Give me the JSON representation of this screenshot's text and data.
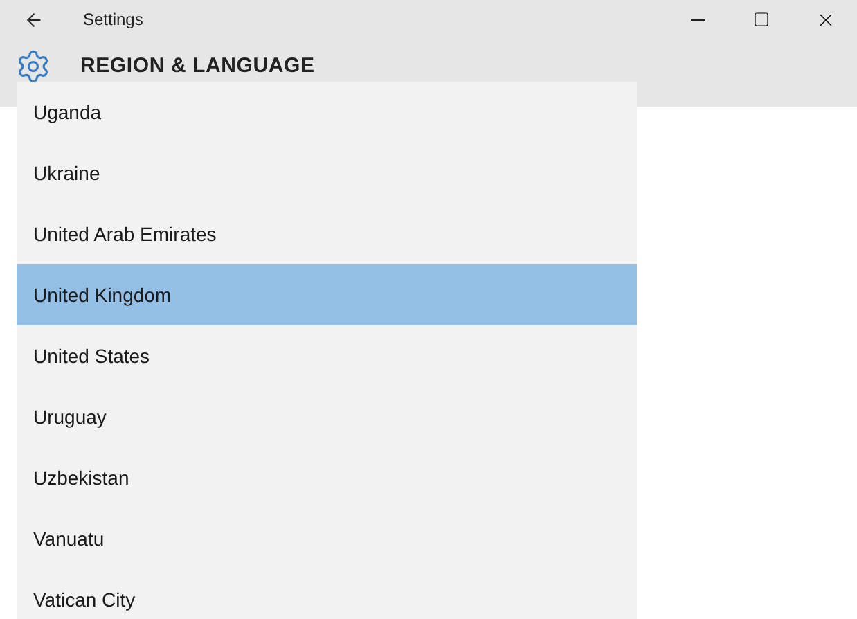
{
  "window": {
    "title": "Settings"
  },
  "header": {
    "title": "REGION & LANGUAGE"
  },
  "dropdown": {
    "items": [
      {
        "label": "Uganda",
        "selected": false
      },
      {
        "label": "Ukraine",
        "selected": false
      },
      {
        "label": "United Arab Emirates",
        "selected": false
      },
      {
        "label": "United Kingdom",
        "selected": true
      },
      {
        "label": "United States",
        "selected": false
      },
      {
        "label": "Uruguay",
        "selected": false
      },
      {
        "label": "Uzbekistan",
        "selected": false
      },
      {
        "label": "Vanuatu",
        "selected": false
      },
      {
        "label": "Vatican City",
        "selected": false
      }
    ]
  }
}
